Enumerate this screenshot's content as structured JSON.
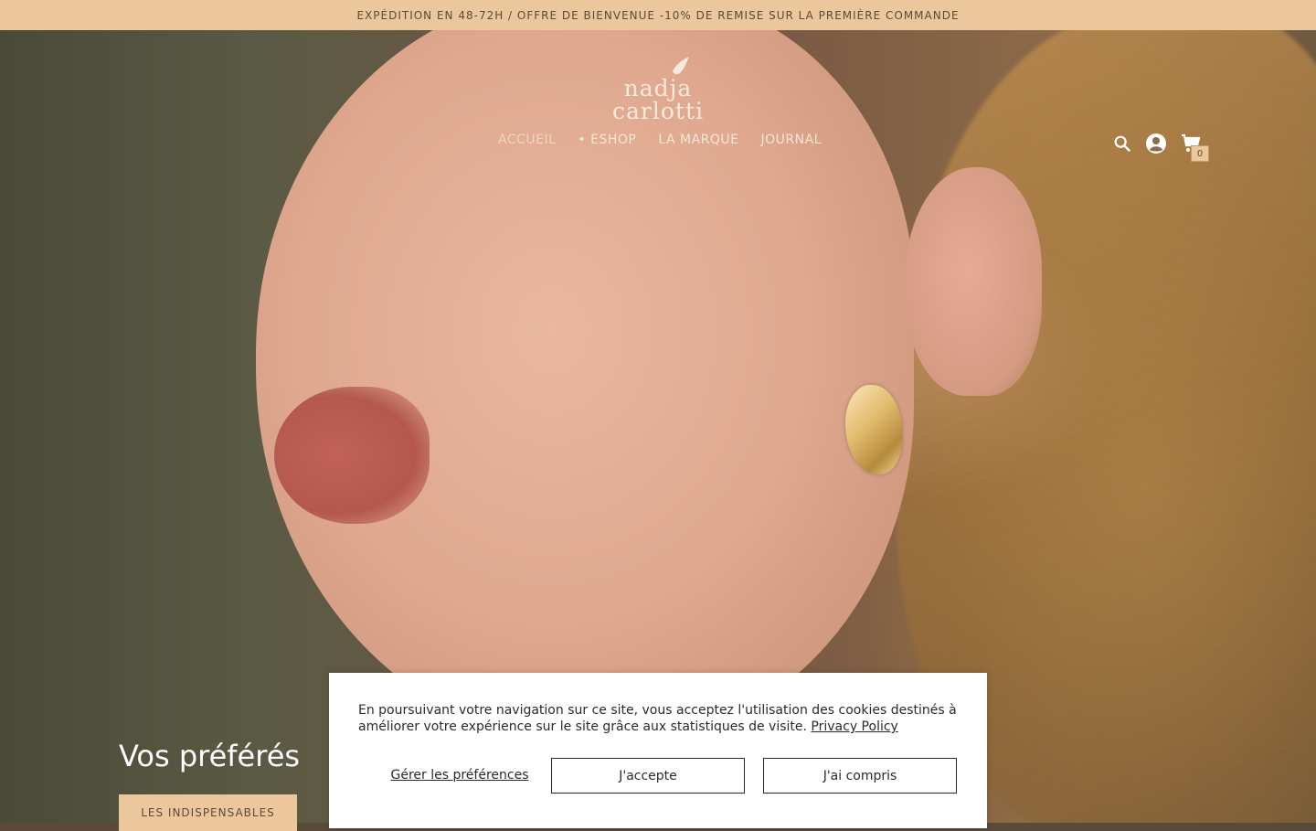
{
  "announcement": "EXPÉDITION EN 48-72H / OFFRE DE BIENVENUE -10% DE REMISE SUR LA PREMIÈRE COMMANDE",
  "brand": {
    "line1": "nadja",
    "line2": "carlotti"
  },
  "nav": {
    "items": [
      "ACCUEIL",
      "• ESHOP",
      "LA MARQUE",
      "JOURNAL"
    ]
  },
  "header_icons": {
    "search": "search-icon",
    "account": "account-icon",
    "cart": "cart-icon",
    "cart_count": "0"
  },
  "hero": {
    "headline": "Vos préférés",
    "cta": "LES INDISPENSABLES"
  },
  "cookie": {
    "message": "En poursuivant votre navigation sur ce site, vous acceptez l'utilisation des cookies destinés à améliorer votre expérience sur le site grâce aux statistiques de visite.",
    "privacy_link": "Privacy Policy",
    "manage": "Gérer les préférences",
    "accept": "J'accepte",
    "understood": "J'ai compris"
  },
  "colors": {
    "announcement_bg": "#ecc79b",
    "cta_bg": "#ecc79b",
    "text_dark": "#2a2a2a"
  }
}
